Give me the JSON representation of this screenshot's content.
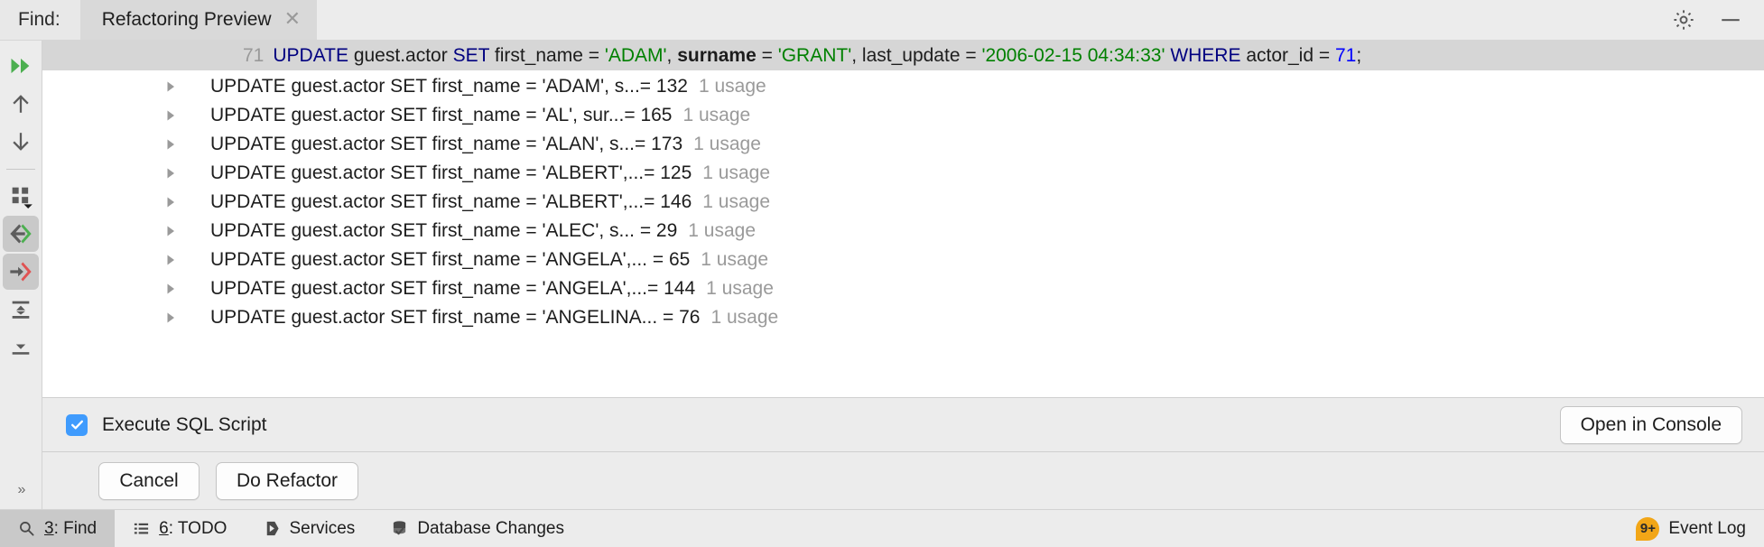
{
  "window": {
    "find_label": "Find:",
    "tab_title": "Refactoring Preview",
    "close_glyph": "✕",
    "settings_icon": "gear-icon",
    "minimize_icon": "minimize-icon"
  },
  "rail": {
    "items": [
      {
        "name": "rerun-icon",
        "label": "Rerun",
        "active": false
      },
      {
        "name": "previous-occurrence-icon",
        "label": "Previous Occurrence",
        "active": false
      },
      {
        "name": "next-occurrence-icon",
        "label": "Next Occurrence",
        "active": false
      },
      {
        "name": "group-by-icon",
        "label": "Group By",
        "active": false
      },
      {
        "name": "show-read-access-icon",
        "label": "Show Read Access",
        "active": true
      },
      {
        "name": "show-write-access-icon",
        "label": "Show Write Access",
        "active": true
      },
      {
        "name": "expand-all-icon",
        "label": "Expand All",
        "active": false
      },
      {
        "name": "collapse-all-icon",
        "label": "Collapse All",
        "active": false
      }
    ],
    "overflow_glyph": "»"
  },
  "preview": {
    "line_number": "71",
    "tokens": [
      {
        "t": "UPDATE ",
        "c": "kw"
      },
      {
        "t": "guest.actor ",
        "c": "plain"
      },
      {
        "t": "SET ",
        "c": "kw"
      },
      {
        "t": "first_name = ",
        "c": "plain"
      },
      {
        "t": "'ADAM'",
        "c": "str"
      },
      {
        "t": ", ",
        "c": "plain"
      },
      {
        "t": "surname",
        "c": "bold"
      },
      {
        "t": " = ",
        "c": "plain"
      },
      {
        "t": "'GRANT'",
        "c": "str"
      },
      {
        "t": ", last_update = ",
        "c": "plain"
      },
      {
        "t": "'2006-02-15 04:34:33'",
        "c": "str"
      },
      {
        "t": " ",
        "c": "plain"
      },
      {
        "t": "WHERE ",
        "c": "kw"
      },
      {
        "t": "actor_id = ",
        "c": "plain"
      },
      {
        "t": "71",
        "c": "num"
      },
      {
        "t": ";",
        "c": "plain"
      }
    ]
  },
  "results": {
    "usage_suffix": "1 usage",
    "rows": [
      {
        "text": "UPDATE guest.actor SET first_name = 'ADAM', s...= 132",
        "usage": "1 usage"
      },
      {
        "text": "UPDATE guest.actor SET first_name = 'AL', sur...= 165",
        "usage": "1 usage"
      },
      {
        "text": "UPDATE guest.actor SET first_name = 'ALAN', s...= 173",
        "usage": "1 usage"
      },
      {
        "text": "UPDATE guest.actor SET first_name = 'ALBERT',...= 125",
        "usage": "1 usage"
      },
      {
        "text": "UPDATE guest.actor SET first_name = 'ALBERT',...= 146",
        "usage": "1 usage"
      },
      {
        "text": "UPDATE guest.actor SET first_name = 'ALEC', s... = 29",
        "usage": "1 usage"
      },
      {
        "text": "UPDATE guest.actor SET first_name = 'ANGELA',... = 65",
        "usage": "1 usage"
      },
      {
        "text": "UPDATE guest.actor SET first_name = 'ANGELA',...= 144",
        "usage": "1 usage"
      },
      {
        "text": "UPDATE guest.actor SET first_name = 'ANGELINA... = 76",
        "usage": "1 usage"
      }
    ]
  },
  "options": {
    "execute_sql_label": "Execute SQL Script",
    "execute_sql_checked": true,
    "open_in_console_label": "Open in Console"
  },
  "actions": {
    "cancel_label": "Cancel",
    "do_refactor_label": "Do Refactor"
  },
  "statusbar": {
    "items": [
      {
        "mnemonic": "3",
        "label": ": Find",
        "icon": "search-icon",
        "selected": true
      },
      {
        "mnemonic": "6",
        "label": ": TODO",
        "icon": "list-icon",
        "selected": false
      },
      {
        "mnemonic": "",
        "label": "Services",
        "icon": "play-hex-icon",
        "selected": false
      },
      {
        "mnemonic": "",
        "label": "Database Changes",
        "icon": "database-check-icon",
        "selected": false
      }
    ],
    "event_log_label": "Event Log",
    "event_log_badge": "9+"
  },
  "colors": {
    "accent_blue": "#3f9bfd",
    "keyword": "#000080",
    "string": "#008000",
    "number": "#0000ff",
    "badge_orange": "#f2a617",
    "selected_gray": "#c9c9c9"
  }
}
